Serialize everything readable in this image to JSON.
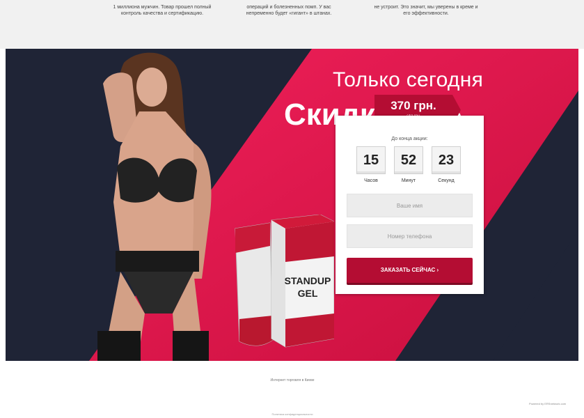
{
  "features": [
    {
      "text": "1 миллиона мужчин. Товар прошел полный контроль качества и сертификацию."
    },
    {
      "text": "операций и болезненных помп. У вас непременно будет «гигант» в штанах."
    },
    {
      "text": "не устроит. Это значит, мы уверены в креме и его эффективности."
    }
  ],
  "hero": {
    "line1": "Только сегодня",
    "line2": "Скидка 50%"
  },
  "product": {
    "name_line1": "STANDUP",
    "name_line2": "GEL"
  },
  "price": {
    "current": "370 грн.",
    "old": "740 грн."
  },
  "timer": {
    "caption": "До конца акции:",
    "hours": "15",
    "minutes": "52",
    "seconds": "23",
    "hours_label": "Часов",
    "minutes_label": "Минут",
    "seconds_label": "Секунд"
  },
  "form": {
    "name_placeholder": "Ваше имя",
    "phone_placeholder": "Номер телефона",
    "submit_label": "ЗАКАЗАТЬ СЕЙЧАС ›"
  },
  "footer": {
    "note": "Интернет торговля в Киеве",
    "powered": "Powered by ERSnetwork.com",
    "privacy": "Политика конфиденциальности"
  },
  "colors": {
    "accent": "#e8174a",
    "dark": "#1f2436",
    "button": "#b40d33"
  }
}
